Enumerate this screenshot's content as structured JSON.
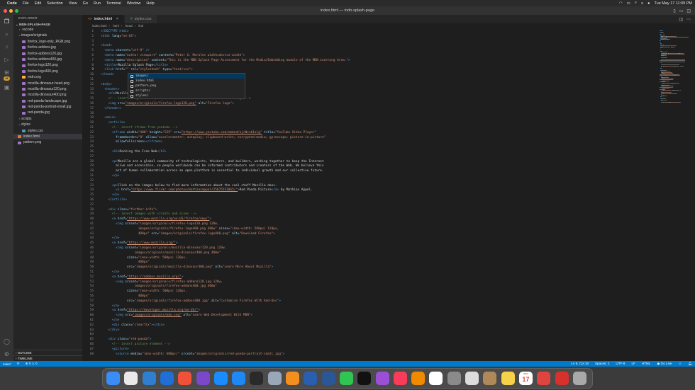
{
  "menubar": {
    "app_name": "Code",
    "items": [
      "File",
      "Edit",
      "Selection",
      "View",
      "Go",
      "Run",
      "Terminal",
      "Window",
      "Help"
    ],
    "clock": "Tue May 17  11:09 PM"
  },
  "window": {
    "title": "index.html — mdn-splash-page"
  },
  "sidebar": {
    "header": "EXPLORER",
    "project": "MDN-SPLASH-PAGE",
    "tree": [
      {
        "label": ".vscode",
        "type": "folder",
        "indent": 1,
        "expanded": false
      },
      {
        "label": "images/originals",
        "type": "folder",
        "indent": 1,
        "expanded": true
      },
      {
        "label": "firefox_logo-only_RGB.png",
        "type": "image",
        "indent": 2
      },
      {
        "label": "firefox-addons.jpg",
        "type": "image",
        "indent": 2
      },
      {
        "label": "firefox-addons120.jpg",
        "type": "image",
        "indent": 2
      },
      {
        "label": "firefox-addons400.jpg",
        "type": "image",
        "indent": 2
      },
      {
        "label": "firefox-logo120.png",
        "type": "image",
        "indent": 2
      },
      {
        "label": "firefox-logo400.png",
        "type": "image",
        "indent": 2
      },
      {
        "label": "mdn.svg",
        "type": "svg",
        "indent": 2
      },
      {
        "label": "mozilla-dinosaur-head.png",
        "type": "image",
        "indent": 2
      },
      {
        "label": "mozilla-dinosaur120.png",
        "type": "image",
        "indent": 2
      },
      {
        "label": "mozilla-dinosaur400.png",
        "type": "image",
        "indent": 2
      },
      {
        "label": "red-panda-landscape.jpg",
        "type": "image",
        "indent": 2
      },
      {
        "label": "red-panda-portrait-small.jpg",
        "type": "image",
        "indent": 2
      },
      {
        "label": "red-panda.jpg",
        "type": "image",
        "indent": 2
      },
      {
        "label": "scripts",
        "type": "folder",
        "indent": 1,
        "expanded": false
      },
      {
        "label": "styles",
        "type": "folder",
        "indent": 1,
        "expanded": true
      },
      {
        "label": "styles.css",
        "type": "css",
        "indent": 2
      },
      {
        "label": "index.html",
        "type": "html",
        "indent": 1,
        "selected": true
      },
      {
        "label": "pattern.png",
        "type": "image",
        "indent": 1
      }
    ],
    "outline": "OUTLINE",
    "timeline": "TIMELINE"
  },
  "tabs": [
    {
      "label": "index.html",
      "active": true,
      "icon": "html-file-icon"
    },
    {
      "label": "styles.css",
      "active": false,
      "icon": "css-file-icon"
    }
  ],
  "breadcrumb": [
    "index.html",
    "html",
    "head",
    "link"
  ],
  "autocomplete": [
    "images/",
    "index.html",
    "pattern.png",
    "scripts/",
    "styles/"
  ],
  "code_lines": [
    [
      [
        "t",
        "<!DOCTYPE html>"
      ]
    ],
    [
      [
        "t",
        "<html "
      ],
      [
        "a",
        "lang"
      ],
      [
        "x",
        "="
      ],
      [
        "s",
        "\"en-US\""
      ],
      [
        "t",
        ">"
      ]
    ],
    [],
    [
      [
        "t",
        "<head>"
      ]
    ],
    [
      [
        "x",
        "  "
      ],
      [
        "t",
        "<meta "
      ],
      [
        "a",
        "charset"
      ],
      [
        "x",
        "="
      ],
      [
        "s",
        "\"utf-8\""
      ],
      [
        "t",
        " />"
      ]
    ],
    [
      [
        "x",
        "  "
      ],
      [
        "t",
        "<meta "
      ],
      [
        "a",
        "name"
      ],
      [
        "x",
        "="
      ],
      [
        "s",
        "\"author viewport\""
      ],
      [
        "x",
        " "
      ],
      [
        "a",
        "content"
      ],
      [
        "x",
        "="
      ],
      [
        "s",
        "\"Peter G. Morales width=device-width\""
      ],
      [
        "t",
        ">"
      ]
    ],
    [
      [
        "x",
        "  "
      ],
      [
        "t",
        "<meta "
      ],
      [
        "a",
        "name"
      ],
      [
        "x",
        "="
      ],
      [
        "s",
        "\"description\""
      ],
      [
        "x",
        " "
      ],
      [
        "a",
        "content"
      ],
      [
        "x",
        "="
      ],
      [
        "s",
        "\"This is the MDN Splash Page Assessment for the Media/Embedding module of the MDN Learning Area.\""
      ],
      [
        "t",
        ">"
      ]
    ],
    [
      [
        "x",
        "  "
      ],
      [
        "t",
        "<title>"
      ],
      [
        "x",
        "Mozilla Splash Page"
      ],
      [
        "t",
        "</title>"
      ]
    ],
    [
      [
        "x",
        "  "
      ],
      [
        "t",
        "<link "
      ],
      [
        "a",
        "href"
      ],
      [
        "x",
        "="
      ],
      [
        "s",
        "\"\""
      ],
      [
        "x",
        " "
      ],
      [
        "a",
        "rel"
      ],
      [
        "x",
        "="
      ],
      [
        "s",
        "\"stylesheet\""
      ],
      [
        "x",
        " "
      ],
      [
        "a",
        "type"
      ],
      [
        "x",
        "="
      ],
      [
        "s",
        "\"text/css\""
      ],
      [
        "t",
        ">"
      ]
    ],
    [
      [
        "t",
        "</head>"
      ]
    ],
    [],
    [
      [
        "t",
        "<body>"
      ]
    ],
    [
      [
        "x",
        "  "
      ],
      [
        "t",
        "<header>"
      ]
    ],
    [
      [
        "x",
        "    "
      ],
      [
        "t",
        "<h1>"
      ],
      [
        "x",
        "Mozilla"
      ],
      [
        "t",
        "</h1>"
      ]
    ],
    [
      [
        "x",
        "    "
      ],
      [
        "c",
        "<!-- insert <img> element, link to the small version of the Firefox logo -->"
      ]
    ],
    [
      [
        "x",
        "    "
      ],
      [
        "t",
        "<img "
      ],
      [
        "a",
        "src"
      ],
      [
        "x",
        "="
      ],
      [
        "u",
        "\"images/originals/firefox-logo120.png\""
      ],
      [
        "x",
        " "
      ],
      [
        "a",
        "alt"
      ],
      [
        "x",
        "="
      ],
      [
        "s",
        "\"Firefox logo\""
      ],
      [
        "t",
        ">"
      ]
    ],
    [
      [
        "x",
        "  "
      ],
      [
        "t",
        "</header>"
      ]
    ],
    [],
    [
      [
        "x",
        "  "
      ],
      [
        "t",
        "<main>"
      ]
    ],
    [
      [
        "x",
        "    "
      ],
      [
        "t",
        "<article>"
      ]
    ],
    [
      [
        "x",
        "      "
      ],
      [
        "c",
        "<!-- insert iframe from youtube -->"
      ]
    ],
    [
      [
        "x",
        "      "
      ],
      [
        "t",
        "<iframe "
      ],
      [
        "a",
        "width"
      ],
      [
        "x",
        "="
      ],
      [
        "s",
        "\"400\""
      ],
      [
        "x",
        " "
      ],
      [
        "a",
        "height"
      ],
      [
        "x",
        "="
      ],
      [
        "s",
        "\"225\""
      ],
      [
        "x",
        " "
      ],
      [
        "a",
        "src"
      ],
      [
        "x",
        "="
      ],
      [
        "u",
        "\"https://www.youtube.com/embed/ojcNcvb1olg\""
      ],
      [
        "x",
        " "
      ],
      [
        "a",
        "title"
      ],
      [
        "x",
        "="
      ],
      [
        "s",
        "\"YouTube Video Player\""
      ]
    ],
    [
      [
        "x",
        "        "
      ],
      [
        "a",
        "frameborder"
      ],
      [
        "x",
        "="
      ],
      [
        "s",
        "\"0\""
      ],
      [
        "x",
        " "
      ],
      [
        "a",
        "allow"
      ],
      [
        "x",
        "="
      ],
      [
        "s",
        "\"accelerometer; autoplay; clipboard-write; encrypted-media; gyroscope; picture-in-picture\""
      ]
    ],
    [
      [
        "x",
        "        "
      ],
      [
        "a",
        "allowfullscreen"
      ],
      [
        "t",
        "></iframe>"
      ]
    ],
    [],
    [
      [
        "x",
        "      "
      ],
      [
        "t",
        "<h2>"
      ],
      [
        "x",
        "Rocking the Free Web"
      ],
      [
        "t",
        "</h2>"
      ]
    ],
    [],
    [
      [
        "x",
        "      "
      ],
      [
        "t",
        "<p>"
      ],
      [
        "x",
        "Mozilla are a global community of technologists, thinkers, and builders, working together to keep the Internet"
      ]
    ],
    [
      [
        "x",
        "        alive and accessible, so people worldwide can be informed contributors and creators of the Web. We believe this"
      ]
    ],
    [
      [
        "x",
        "        act of human collaboration across an open platform is essential to individual growth and our collective future."
      ]
    ],
    [
      [
        "x",
        "      "
      ],
      [
        "t",
        "</p>"
      ]
    ],
    [],
    [
      [
        "x",
        "      "
      ],
      [
        "t",
        "<p>"
      ],
      [
        "x",
        "Click on the images below to find more information about the cool stuff Mozilla does."
      ]
    ],
    [
      [
        "x",
        "        "
      ],
      [
        "t",
        "<a "
      ],
      [
        "a",
        "href"
      ],
      [
        "x",
        "="
      ],
      [
        "u",
        "\"https://www.flickr.com/photos/mathiasappel/25675551065/\""
      ],
      [
        "t",
        ">"
      ],
      [
        "x",
        "Red Panda Picture"
      ],
      [
        "t",
        "</a>"
      ],
      [
        "x",
        " by Mathias Appel."
      ]
    ],
    [
      [
        "x",
        "      "
      ],
      [
        "t",
        "</p>"
      ]
    ],
    [
      [
        "x",
        "    "
      ],
      [
        "t",
        "</article>"
      ]
    ],
    [],
    [
      [
        "x",
        "    "
      ],
      [
        "t",
        "<div "
      ],
      [
        "a",
        "class"
      ],
      [
        "x",
        "="
      ],
      [
        "s",
        "\"further-info\""
      ],
      [
        "t",
        ">"
      ]
    ],
    [
      [
        "x",
        "      "
      ],
      [
        "c",
        "<!-- insert images with srcsets and sizes -->"
      ]
    ],
    [
      [
        "x",
        "      "
      ],
      [
        "t",
        "<a "
      ],
      [
        "a",
        "href"
      ],
      [
        "x",
        "="
      ],
      [
        "u",
        "\"https://www.mozilla.org/en-US/firefox/new/\""
      ],
      [
        "t",
        ">"
      ]
    ],
    [
      [
        "x",
        "        "
      ],
      [
        "t",
        "<img "
      ],
      [
        "a",
        "srcset"
      ],
      [
        "x",
        "="
      ],
      [
        "s",
        "\"images/originals/firefox-logo120.png 120w,"
      ]
    ],
    [
      [
        "s",
        "                    images/originals/firefox-logo400.png 400w\""
      ],
      [
        "x",
        " "
      ],
      [
        "a",
        "sizes"
      ],
      [
        "x",
        "="
      ],
      [
        "s",
        "\"(max-width: 500px) 120px,"
      ]
    ],
    [
      [
        "s",
        "                    400px\""
      ],
      [
        "x",
        " "
      ],
      [
        "a",
        "src"
      ],
      [
        "x",
        "="
      ],
      [
        "s",
        "\"images/originals/firefox-logo400.png\""
      ],
      [
        "x",
        " "
      ],
      [
        "a",
        "alt"
      ],
      [
        "x",
        "="
      ],
      [
        "s",
        "\"Download Firefox\""
      ],
      [
        "t",
        ">"
      ]
    ],
    [
      [
        "x",
        "      "
      ],
      [
        "t",
        "</a>"
      ]
    ],
    [
      [
        "x",
        "      "
      ],
      [
        "t",
        "<a "
      ],
      [
        "a",
        "href"
      ],
      [
        "x",
        "="
      ],
      [
        "u",
        "\"https://www.mozilla.org/\""
      ],
      [
        "t",
        ">"
      ]
    ],
    [
      [
        "x",
        "        "
      ],
      [
        "t",
        "<img "
      ],
      [
        "a",
        "srcset"
      ],
      [
        "x",
        "="
      ],
      [
        "s",
        "\"images/originals/mozilla-dinosaur120.png 120w,"
      ]
    ],
    [
      [
        "s",
        "                  images/originals/mozilla-dinosaur400.png 400w\""
      ]
    ],
    [
      [
        "x",
        "              "
      ],
      [
        "a",
        "sizes"
      ],
      [
        "x",
        "="
      ],
      [
        "s",
        "\"(max-width: 500px) 120px,"
      ]
    ],
    [
      [
        "s",
        "                    400px\""
      ]
    ],
    [
      [
        "x",
        "              "
      ],
      [
        "a",
        "src"
      ],
      [
        "x",
        "="
      ],
      [
        "s",
        "\"images/originals/mozilla-dinosaur400.png\""
      ],
      [
        "x",
        " "
      ],
      [
        "a",
        "alt"
      ],
      [
        "x",
        "="
      ],
      [
        "s",
        "\"Learn More About Mozilla\""
      ],
      [
        "t",
        ">"
      ]
    ],
    [
      [
        "x",
        "      "
      ],
      [
        "t",
        "</a>"
      ]
    ],
    [
      [
        "x",
        "      "
      ],
      [
        "t",
        "<a "
      ],
      [
        "a",
        "href"
      ],
      [
        "x",
        "="
      ],
      [
        "u",
        "\"https://addons.mozilla.org/\""
      ],
      [
        "t",
        ">"
      ]
    ],
    [
      [
        "x",
        "        "
      ],
      [
        "t",
        "<img "
      ],
      [
        "a",
        "srcset"
      ],
      [
        "x",
        "="
      ],
      [
        "s",
        "\"images/originals/firefox-addons120.jpg 120w,"
      ]
    ],
    [
      [
        "s",
        "                  images/originals/firefox-addons400.jpg 400w\""
      ]
    ],
    [
      [
        "x",
        "              "
      ],
      [
        "a",
        "sizes"
      ],
      [
        "x",
        "="
      ],
      [
        "s",
        "\"(max-width: 500px) 120px,"
      ]
    ],
    [
      [
        "s",
        "                    400px\""
      ]
    ],
    [
      [
        "x",
        "              "
      ],
      [
        "a",
        "src"
      ],
      [
        "x",
        "="
      ],
      [
        "s",
        "\"images/originals/firefox-addons400.jpg\""
      ],
      [
        "x",
        " "
      ],
      [
        "a",
        "alt"
      ],
      [
        "x",
        "="
      ],
      [
        "s",
        "\"Customize Firefox With Add-Ons\""
      ],
      [
        "t",
        ">"
      ]
    ],
    [
      [
        "x",
        "      "
      ],
      [
        "t",
        "</a>"
      ]
    ],
    [
      [
        "x",
        "      "
      ],
      [
        "t",
        "<a "
      ],
      [
        "a",
        "href"
      ],
      [
        "x",
        "="
      ],
      [
        "u",
        "\"https://developer.mozilla.org/en-US/\""
      ],
      [
        "t",
        ">"
      ]
    ],
    [
      [
        "x",
        "        "
      ],
      [
        "t",
        "<img "
      ],
      [
        "a",
        "src"
      ],
      [
        "x",
        "="
      ],
      [
        "u",
        "\"images/originals/mdn.svg\""
      ],
      [
        "x",
        " "
      ],
      [
        "a",
        "alt"
      ],
      [
        "x",
        "="
      ],
      [
        "s",
        "\"Learn Web Development With MDN\""
      ],
      [
        "t",
        ">"
      ]
    ],
    [
      [
        "x",
        "      "
      ],
      [
        "t",
        "</a>"
      ]
    ],
    [
      [
        "x",
        "      "
      ],
      [
        "t",
        "<div "
      ],
      [
        "a",
        "class"
      ],
      [
        "x",
        "="
      ],
      [
        "s",
        "\"clearfix\""
      ],
      [
        "t",
        "></div>"
      ]
    ],
    [
      [
        "x",
        "    "
      ],
      [
        "t",
        "</div>"
      ]
    ],
    [],
    [
      [
        "x",
        "    "
      ],
      [
        "t",
        "<div "
      ],
      [
        "a",
        "class"
      ],
      [
        "x",
        "="
      ],
      [
        "s",
        "\"red-panda\""
      ],
      [
        "t",
        ">"
      ]
    ],
    [
      [
        "x",
        "      "
      ],
      [
        "c",
        "<!-- insert picture element -->"
      ]
    ],
    [
      [
        "x",
        "      "
      ],
      [
        "t",
        "<picture>"
      ]
    ],
    [
      [
        "x",
        "        "
      ],
      [
        "t",
        "<source "
      ],
      [
        "a",
        "media"
      ],
      [
        "x",
        "="
      ],
      [
        "s",
        "\"(max-width: 600px)\""
      ],
      [
        "x",
        " "
      ],
      [
        "a",
        "srcset"
      ],
      [
        "x",
        "="
      ],
      [
        "s",
        "\"images/originals/red-panda-portrait-small.jpg\""
      ],
      [
        "t",
        ">"
      ]
    ]
  ],
  "status": {
    "branch": "main*",
    "sync": "⟳",
    "problems": "⊗ 0 ⚠ 0",
    "position": "Ln 9, Col 16",
    "spaces": "Spaces: 2",
    "encoding": "UTF-8",
    "eol": "LF",
    "language": "HTML",
    "golive": "◉ Go Live"
  },
  "dock": {
    "calendar_month": "MAY",
    "calendar_day": "17",
    "apps": [
      "finder-icon",
      "chrome-icon",
      "vscode-icon",
      "xcode-icon",
      "swift-icon",
      "github-desktop-icon",
      "safari-icon",
      "app-store-icon",
      "terminal-icon",
      "preview-icon",
      "books-icon",
      "todoist-icon",
      "word-icon",
      "messages-icon",
      "tv-icon",
      "podcasts-icon",
      "music-icon",
      "vlc-icon",
      "photos-icon",
      "system-preferences-icon",
      "chess-icon",
      "archive-icon",
      "notes-icon",
      "calendar-icon",
      "slack-icon",
      "flow-icon",
      "trash-icon"
    ]
  },
  "colors": {
    "accent": "#007acc",
    "editor_bg": "#1e1e1e",
    "sidebar_bg": "#252526",
    "tag": "#569cd6",
    "attr": "#9cdcfe",
    "string": "#ce9178",
    "comment": "#6a9955"
  }
}
